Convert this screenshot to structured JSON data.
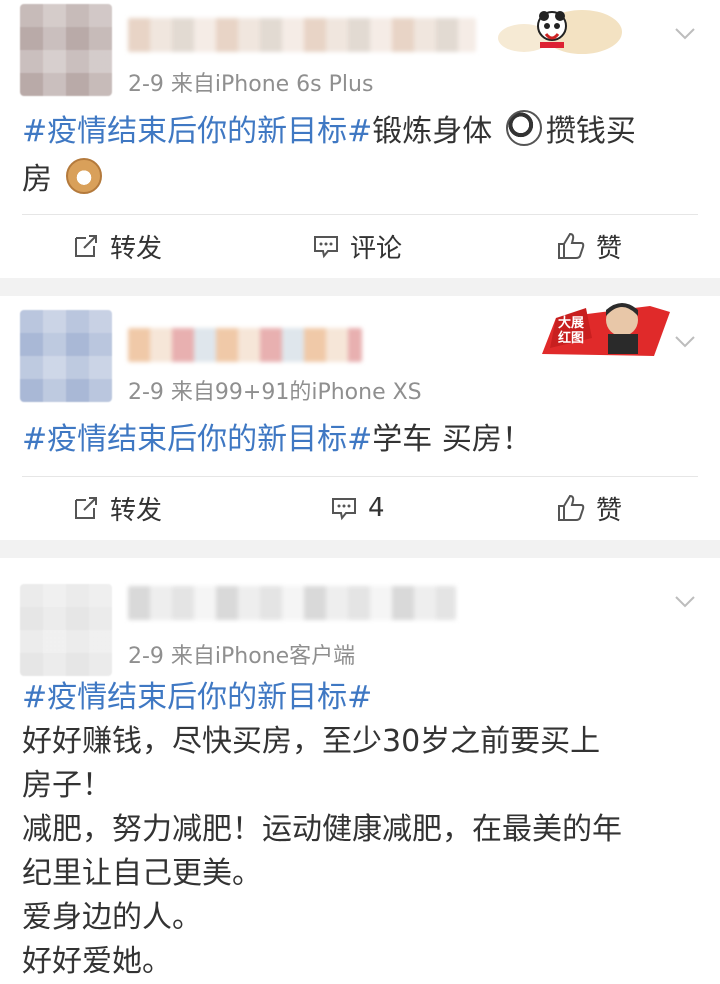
{
  "posts": [
    {
      "meta": "2-9  来自iPhone 6s Plus",
      "topic": "#疫情结束后你的新目标#",
      "text_a": "锻炼身体",
      "text_b": "攒钱买",
      "text_c": "房",
      "actions": {
        "repost": "转发",
        "comment": "评论",
        "like": "赞"
      }
    },
    {
      "meta": "2-9  来自99+91的iPhone XS",
      "topic": "#疫情结束后你的新目标#",
      "text": "学车 买房！",
      "sticker_text": "大展红图",
      "actions": {
        "repost": "转发",
        "comment": "4",
        "like": "赞"
      }
    },
    {
      "meta": "2-9  来自iPhone客户端",
      "topic": "#疫情结束后你的新目标#",
      "lines": [
        "好好赚钱，尽快买房，至少30岁之前要买上",
        "房子！",
        "减肥，努力减肥！运动健康减肥，在最美的年",
        "纪里让自己更美。",
        "爱身边的人。",
        "好好爱她。"
      ]
    }
  ],
  "colors": {
    "topic": "#3f78c3",
    "meta": "#8f8f8f",
    "text": "#333333",
    "separator": "#f2f2f2"
  },
  "icons": [
    "chevron-down-icon",
    "repost-icon",
    "comment-icon",
    "like-icon",
    "panda-sticker-icon",
    "red-banner-sticker-icon",
    "dog-emoji-icon",
    "cat-emoji-icon"
  ]
}
